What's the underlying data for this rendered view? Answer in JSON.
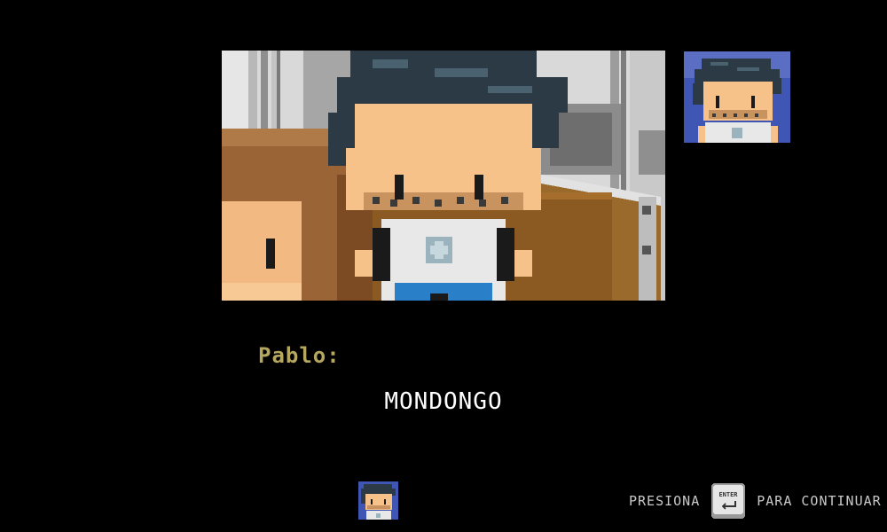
{
  "dialogue": {
    "speaker": "Pablo:",
    "line": "MONDONGO"
  },
  "prompt": {
    "before": "PRESIONA",
    "key_label": "ENTER",
    "after": "PARA CONTINUAR"
  },
  "colors": {
    "background": "#000000",
    "speaker_name": "#b5a760",
    "dialogue_text": "#ffffff",
    "prompt_text": "#c9c9c9",
    "skin": "#f7c28a",
    "hair": "#2b3a44",
    "portrait_bg": "#3f56b5"
  },
  "icons": {
    "scene": "pixel-art-cutscene",
    "portrait": "character-portrait",
    "mini_portrait": "character-mini-portrait",
    "key": "enter-key-icon"
  }
}
